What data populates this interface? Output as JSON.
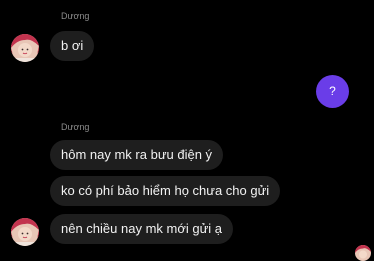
{
  "conversation": {
    "groups": [
      {
        "sender": "Dương",
        "messages": [
          "b ơi"
        ]
      },
      {
        "sender": "Dương",
        "messages": [
          "hôm nay mk ra bưu điện ý",
          "ko có phí bảo hiểm họ chưa cho gửi",
          "nên chiều nay mk mới gửi ạ"
        ]
      }
    ],
    "sent_message": "?"
  },
  "colors": {
    "background": "#000000",
    "received_bubble": "#1e1e1e",
    "sent_bubble": "#6a3de8",
    "sender_name": "#8b8b8b"
  },
  "icons": {
    "avatar": "contact-avatar-icon",
    "read_receipt": "read-receipt-avatar-icon"
  }
}
